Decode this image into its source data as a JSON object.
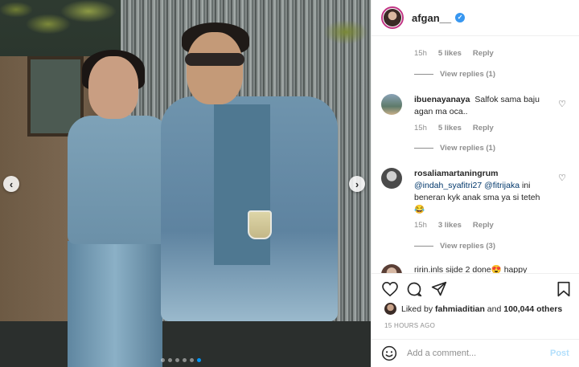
{
  "header": {
    "username": "afgan__",
    "verified": true
  },
  "comments": {
    "first_meta": {
      "time": "15h",
      "likes": "5 likes",
      "reply": "Reply"
    },
    "first_view_replies": "View replies (1)",
    "items": [
      {
        "user": "ibuenayanaya",
        "text": "Salfok sama baju agan ma oca..",
        "time": "15h",
        "likes": "5 likes",
        "reply": "Reply",
        "view_replies": "View replies (1)"
      },
      {
        "user": "rosaliamartaningrum",
        "mention1": "@indah_syafitri27",
        "mention2": "@fitrijaka",
        "text": "ini beneran kyk anak sma ya si teteh",
        "emoji": "😂",
        "time": "15h",
        "likes": "3 likes",
        "reply": "Reply",
        "view_replies": "View replies (3)"
      }
    ],
    "partial_comment": "ririn.inls sijde 2 done😍 happy"
  },
  "actions": {
    "liked_by_prefix": "Liked by",
    "liked_by_user": "fahmiaditian",
    "liked_by_connector": "and",
    "liked_by_count": "100,044 others",
    "timestamp": "15 HOURS AGO"
  },
  "add_comment": {
    "placeholder": "Add a comment...",
    "post_label": "Post"
  },
  "carousel": {
    "total_slides": 6,
    "active_slide": 5
  },
  "colors": {
    "verified": "#3897f0",
    "link": "#00376b",
    "post_disabled": "#b2dffc",
    "active_dot": "#0095f6"
  }
}
